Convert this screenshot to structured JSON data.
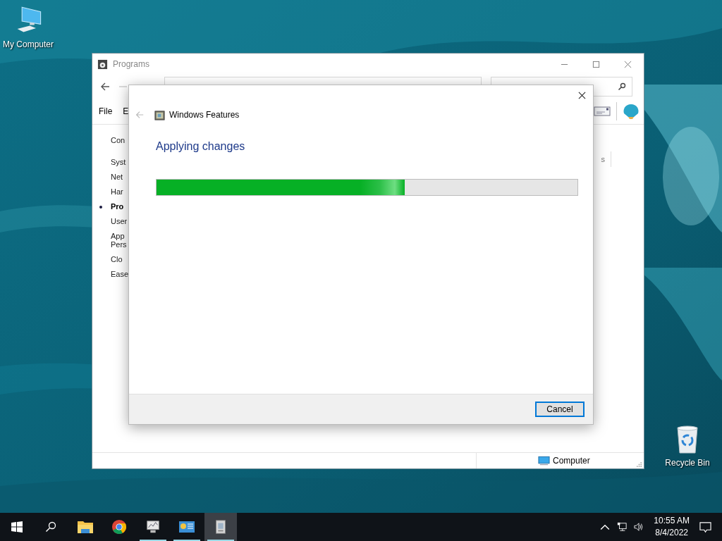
{
  "desktop_icons": [
    {
      "label": "My Computer",
      "kind": "computer"
    },
    {
      "label": "Recycle Bin",
      "kind": "recycle"
    }
  ],
  "explorer_window": {
    "title": "Programs",
    "menu": [
      "File",
      "E"
    ],
    "sidebar": [
      {
        "lines": [
          "Con"
        ],
        "selected": false
      },
      {
        "lines": [
          "Syst"
        ],
        "selected": false
      },
      {
        "lines": [
          "Net"
        ],
        "selected": false
      },
      {
        "lines": [
          "Har"
        ],
        "selected": false
      },
      {
        "lines": [
          "Pro"
        ],
        "selected": true
      },
      {
        "lines": [
          "User"
        ],
        "selected": false
      },
      {
        "lines": [
          "App",
          "Pers"
        ],
        "selected": false
      },
      {
        "lines": [
          "Clo"
        ],
        "selected": false
      },
      {
        "lines": [
          "Ease"
        ],
        "selected": false
      }
    ],
    "content_fragment": "s",
    "status_bar": {
      "location": "Computer"
    }
  },
  "dialog": {
    "title": "Windows Features",
    "heading": "Applying changes",
    "progress": {
      "level": 0.59
    },
    "buttons": [
      {
        "label": "Cancel",
        "focused": true
      }
    ]
  },
  "taskbar": {
    "apps": [
      {
        "kind": "explorer",
        "running": false,
        "selected": false
      },
      {
        "kind": "chrome",
        "running": false,
        "selected": false
      },
      {
        "kind": "monitor",
        "running": true,
        "selected": false
      },
      {
        "kind": "panel",
        "running": true,
        "selected": false
      },
      {
        "kind": "installer",
        "running": true,
        "selected": true
      }
    ],
    "clock": {
      "time": "10:55 AM",
      "date": "8/4/2022"
    }
  }
}
